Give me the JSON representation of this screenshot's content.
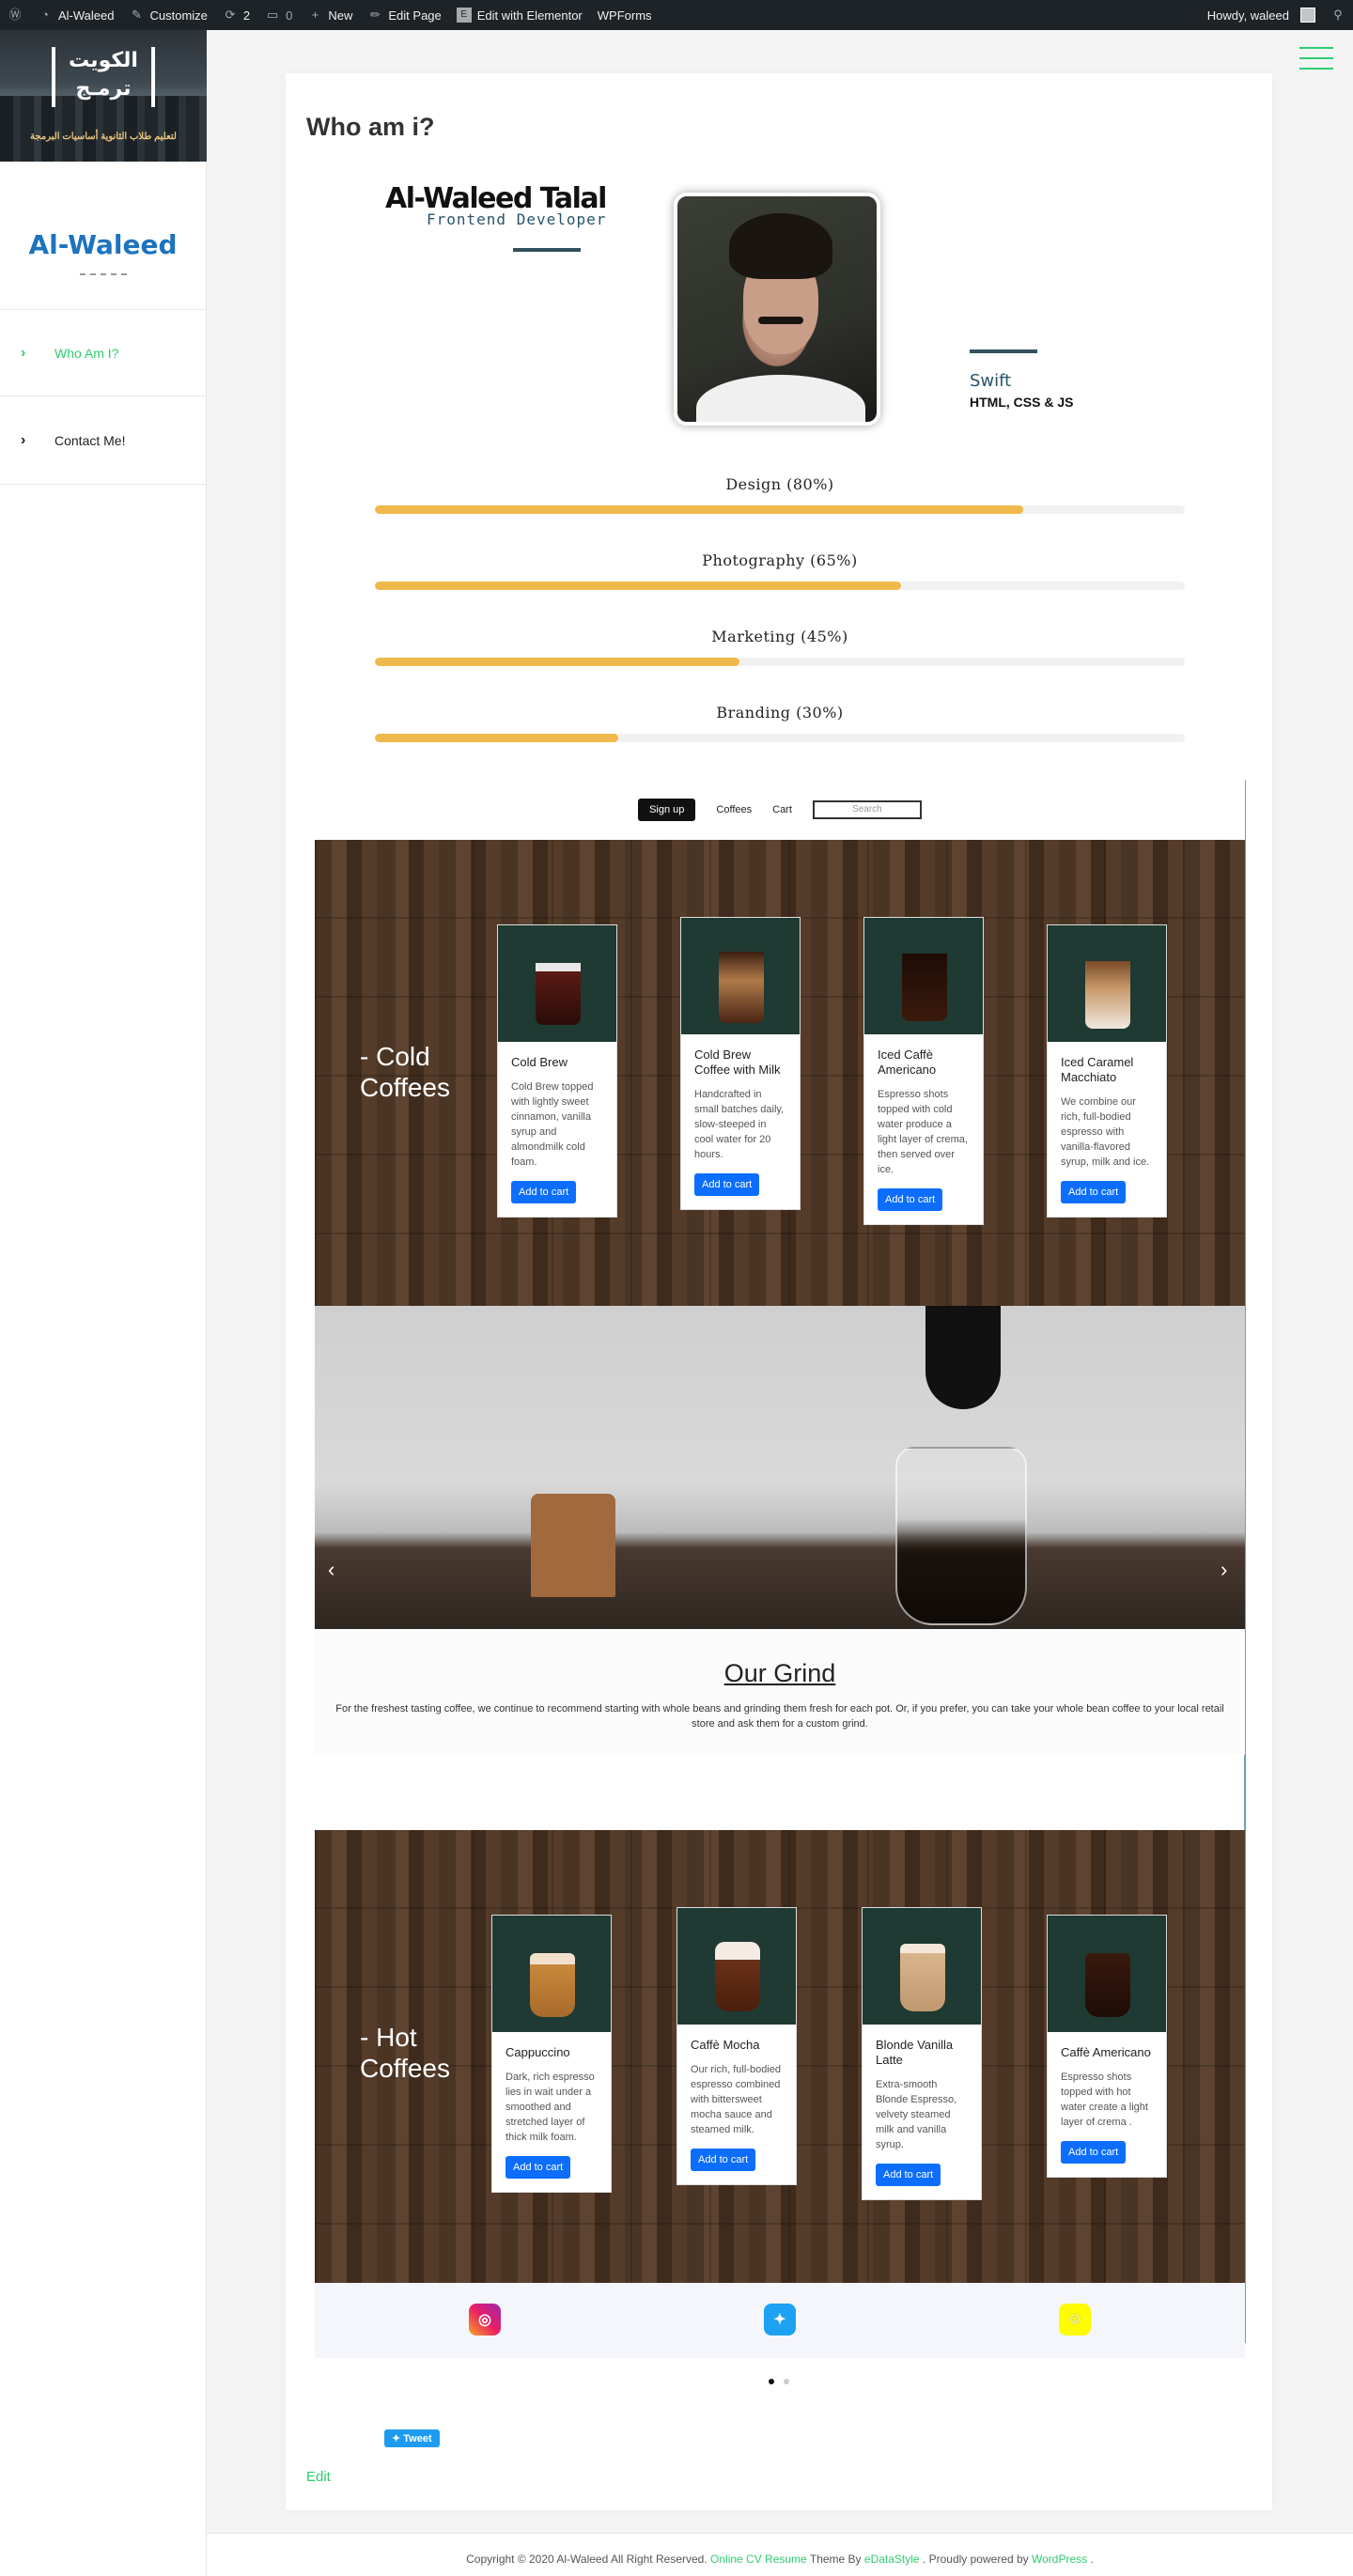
{
  "adminbar": {
    "site": "Al-Waleed",
    "customize": "Customize",
    "updates": "2",
    "comments": "0",
    "new": "New",
    "edit_page": "Edit Page",
    "elementor": "Edit with Elementor",
    "wpforms": "WPForms",
    "howdy": "Howdy, waleed"
  },
  "sidebar": {
    "logo_text_top": "الكويت",
    "logo_text_bottom": "ترمـج",
    "logo_sub": "لتعليم طلاب الثانوية أساسيات البرمجة",
    "site_name": "Al-Waleed",
    "menu": [
      {
        "label": "Who Am I?",
        "active": true
      },
      {
        "label": "Contact Me!",
        "active": false
      }
    ]
  },
  "page": {
    "title": "Who am i?",
    "name": "Al-Waleed Talal",
    "role": "Frontend Developer",
    "skill_title": "Swift",
    "skill_sub": "HTML, CSS & JS",
    "bars": [
      {
        "label": "Design (80%)",
        "percent": 80
      },
      {
        "label": "Photography (65%)",
        "percent": 65
      },
      {
        "label": "Marketing (45%)",
        "percent": 45
      },
      {
        "label": "Branding (30%)",
        "percent": 30
      }
    ]
  },
  "coffee": {
    "nav": {
      "signup": "Sign up",
      "coffees": "Coffees",
      "cart": "Cart",
      "search_placeholder": "Search"
    },
    "cold_title_1": "- Cold",
    "cold_title_2": "Coffees",
    "cold": [
      {
        "name": "Cold Brew",
        "desc": "Cold Brew topped with lightly sweet cinnamon, vanilla syrup and almondmilk cold foam.",
        "button": "Add to cart"
      },
      {
        "name": "Cold Brew Coffee with Milk",
        "desc": "Handcrafted in small batches daily, slow-steeped in cool water for 20 hours.",
        "button": "Add to cart"
      },
      {
        "name": "Iced Caffè Americano",
        "desc": "Espresso shots topped with cold water produce a light layer of crema, then served over ice.",
        "button": "Add to cart"
      },
      {
        "name": "Iced Caramel Macchiato",
        "desc": "We combine our rich, full-bodied espresso with vanilla-flavored syrup, milk and ice.",
        "button": "Add to cart"
      }
    ],
    "grind_title": "Our Grind",
    "grind_text": "For the freshest tasting coffee, we continue to recommend starting with whole beans and grinding them fresh for each pot. Or, if you prefer, you can take your whole bean coffee to your local retail store and ask them for a custom grind.",
    "hot_title_1": "- Hot",
    "hot_title_2": "Coffees",
    "hot": [
      {
        "name": "Cappuccino",
        "desc": "Dark, rich espresso lies in wait under a smoothed and stretched layer of thick milk foam.",
        "button": "Add to cart"
      },
      {
        "name": "Caffè Mocha",
        "desc": "Our rich, full-bodied espresso combined with bittersweet mocha sauce and steamed milk.",
        "button": "Add to cart"
      },
      {
        "name": "Blonde Vanilla Latte",
        "desc": "Extra-smooth Blonde Espresso, velvety steamed milk and vanilla syrup.",
        "button": "Add to cart"
      },
      {
        "name": "Caffè Americano",
        "desc": "Espresso shots topped with hot water create a light layer of crema .",
        "button": "Add to cart"
      }
    ],
    "socials": [
      "instagram-icon",
      "twitter-icon",
      "snapchat-icon"
    ]
  },
  "tweet": "Tweet",
  "edit": "Edit",
  "footer": {
    "copyright": "Copyright © 2020 Al-Waleed All Right Reserved.",
    "theme_link": "Online CV Resume",
    "theme_by": "Theme By",
    "author_link": "eDataStyle",
    "powered": ". Proudly powered by",
    "wp_link": "WordPress",
    "end": "."
  },
  "colors": {
    "accent": "#2ecc71",
    "brand_blue": "#1e73be",
    "bar_fill": "#f0b94b",
    "button_blue": "#0d6efd"
  }
}
